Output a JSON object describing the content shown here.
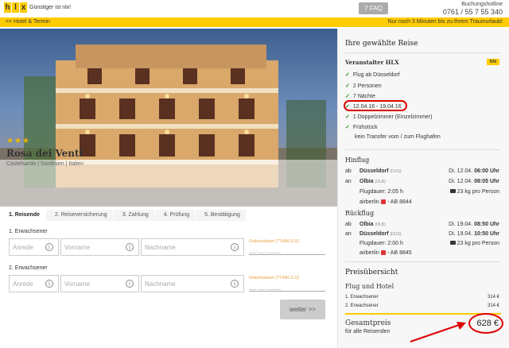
{
  "header": {
    "logo_letters": [
      "h",
      "l",
      "x"
    ],
    "tagline": "Günstiger ist nix!",
    "faq_label": "FAQ",
    "hotline_label": "Buchungshotline",
    "hotline_number": "0761 / 55 7 55 340"
  },
  "subbar": {
    "back_link": "<< Hotel & Termin",
    "countdown": "Nur noch 3 Minuten bis zu Ihrem Traumurlaub!"
  },
  "hotel": {
    "stars": "★★★",
    "name": "Rosa dei Venti",
    "location": "Castelsardo | Sardinien | Italien"
  },
  "steps": [
    "1. Reisende",
    "2. Reiseversicherung",
    "3. Zahlung",
    "4. Prüfung",
    "5. Bestätigung"
  ],
  "form": {
    "adult1_label": "1. Erwachsener",
    "adult2_label": "2. Erwachsener",
    "salutation_placeholder": "Anrede",
    "firstname_placeholder": "Vorname",
    "lastname_placeholder": "Nachname",
    "dob_label": "Geburtsdatum (TT.MM.JJJJ)",
    "dob_value": "__.__.____",
    "info_glyph": "i",
    "next_button": "weiter >>"
  },
  "summary": {
    "title": "Ihre gewählte Reise",
    "operator": "Veranstalter HLX",
    "operator_logo": "hlx",
    "items": [
      "Flug ab Düsseldorf",
      "2 Personen",
      "7 Nächte",
      "12.04.16 - 19.04.16",
      "1 Doppelzimmer (Einzelzimmer)",
      "Frühstück"
    ],
    "transfer": "kein Transfer vom / zum Flughafen",
    "outbound": {
      "title": "Hinflug",
      "ab_label": "ab",
      "an_label": "an",
      "from": "Düsseldorf",
      "from_code": "(DUS)",
      "to": "Olbia",
      "to_code": "(OLB)",
      "dep_date": "Di. 12.04.",
      "dep_time": "06:00 Uhr",
      "arr_date": "Di. 12.04.",
      "arr_time": "08:05 Uhr",
      "duration": "Flugdauer: 2:05 h",
      "baggage": "23 kg pro Person",
      "airline": "airberlin",
      "flight": "- AB 8844"
    },
    "return": {
      "title": "Rückflug",
      "ab_label": "ab",
      "an_label": "an",
      "from": "Olbia",
      "from_code": "(OLB)",
      "to": "Düsseldorf",
      "to_code": "(DUS)",
      "dep_date": "Di. 19.04.",
      "dep_time": "08:50 Uhr",
      "arr_date": "Di. 19.04.",
      "arr_time": "10:50 Uhr",
      "duration": "Flugdauer: 2:00 h",
      "baggage": "23 kg pro Person",
      "airline": "airberlin",
      "flight": "- AB 8845"
    },
    "price_title": "Preisübersicht",
    "price_section": "Flug und Hotel",
    "adult1": "1. Erwachsener",
    "adult1_price": "314 €",
    "adult2": "2. Erwachsener",
    "adult2_price": "314 €",
    "total_label": "Gesamtpreis",
    "total_sub": "für alle Reisenden",
    "total_price": "628 €"
  },
  "colors": {
    "brand_yellow": "#ffcc00",
    "check_green": "#2a8a1a",
    "annotation_red": "#dd0000"
  }
}
